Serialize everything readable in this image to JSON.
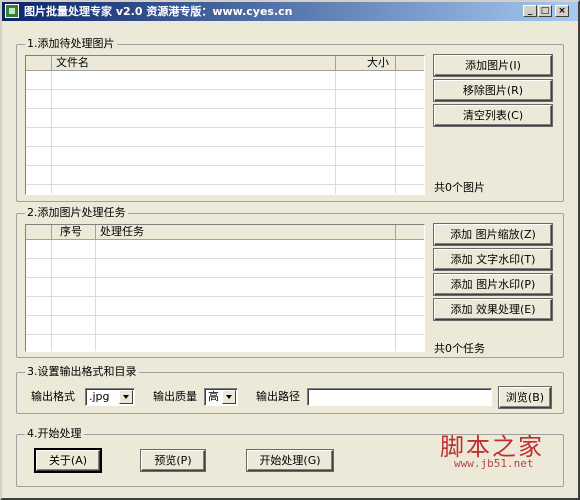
{
  "window": {
    "title": "图片批量处理专家 v2.0 资源港专版：www.cyes.cn",
    "min_label": "_",
    "max_label": "□",
    "close_label": "×"
  },
  "section1": {
    "label": "1.添加待处理图片",
    "columns": [
      "文件名",
      "大小"
    ],
    "rows": 7,
    "add_btn": "添加图片(I)",
    "remove_btn": "移除图片(R)",
    "clear_btn": "清空列表(C)",
    "count": "共0个图片"
  },
  "section2": {
    "label": "2.添加图片处理任务",
    "columns": [
      "序号",
      "处理任务"
    ],
    "rows": 7,
    "scale_btn": "添加 图片缩放(Z)",
    "text_wm_btn": "添加 文字水印(T)",
    "img_wm_btn": "添加 图片水印(P)",
    "effect_btn": "添加 效果处理(E)",
    "count": "共0个任务"
  },
  "section3": {
    "label": "3.设置输出格式和目录",
    "format_label": "输出格式",
    "format_value": ".jpg",
    "quality_label": "输出质量",
    "quality_value": "高",
    "path_label": "输出路径",
    "path_value": "",
    "browse_btn": "浏览(B)"
  },
  "section4": {
    "label": "4.开始处理",
    "about_btn": "关于(A)",
    "preview_btn": "预览(P)",
    "start_btn": "开始处理(G)"
  },
  "watermark": {
    "logo_text": "脚本之家",
    "url_text": "www.jb51.net"
  },
  "colors": {
    "title_start": "#0a246a",
    "title_end": "#a6caf0",
    "face": "#ece9d8",
    "watermark": "#c03030"
  }
}
